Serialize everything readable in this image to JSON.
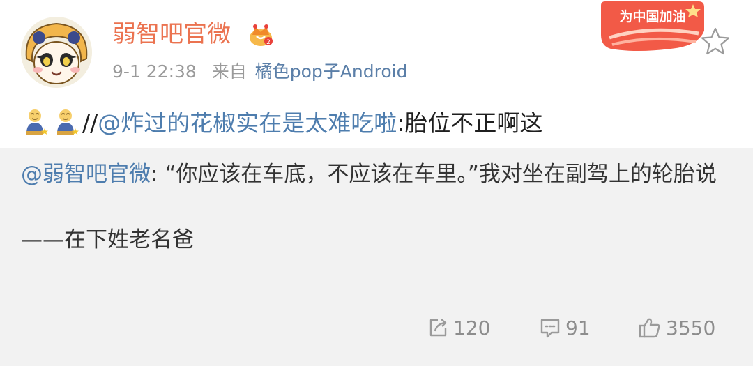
{
  "post": {
    "author": "弱智吧官微",
    "crown_icon": "crown-icon",
    "time": "9-1 22:38",
    "source_prefix": "来自",
    "source": "橘色pop子Android",
    "badge_text": "为中国加油",
    "badge_icon": "china-cheer-badge",
    "star_icon": "star-outline-icon",
    "repost": {
      "emojis": [
        "bowing-figure-emoji",
        "bowing-figure-emoji"
      ],
      "separator": "//",
      "mention": "@炸过的花椒实在是太难吃啦",
      "colon": ":",
      "text": "胎位不正啊这"
    }
  },
  "quoted": {
    "mention": "@弱智吧官微",
    "colon": ": ",
    "text": "“你应该在车底，不应该在车里。”我对坐在副驾上的轮胎说",
    "signature": "——在下姓老名爸"
  },
  "actions": {
    "repost_count": "120",
    "comment_count": "91",
    "like_count": "3550",
    "repost_icon": "share-icon",
    "comment_icon": "comment-icon",
    "like_icon": "thumbs-up-icon"
  },
  "colors": {
    "author": "#eb7350",
    "link": "#4e7dae",
    "quote_bg": "#f2f2f2",
    "muted": "#8d8d8d"
  }
}
